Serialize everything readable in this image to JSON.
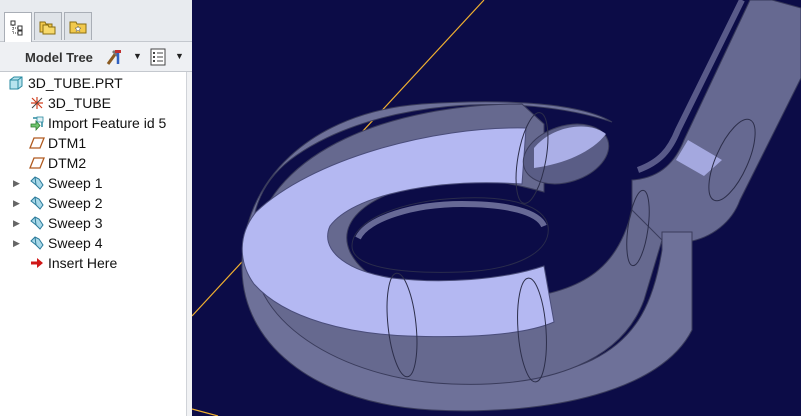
{
  "tabs": {
    "model_tree": "model-tree-tab",
    "folder_browser": "folder-browser-tab",
    "favorites": "favorites-tab"
  },
  "toolbar": {
    "title": "Model Tree"
  },
  "tree": {
    "items": [
      {
        "label": "3D_TUBE.PRT",
        "icon": "part-icon",
        "expandable": false
      },
      {
        "label": "3D_TUBE",
        "icon": "coordinate-system-icon",
        "expandable": false
      },
      {
        "label": "Import Feature id 5",
        "icon": "import-feature-icon",
        "expandable": false
      },
      {
        "label": "DTM1",
        "icon": "datum-plane-icon",
        "expandable": false
      },
      {
        "label": "DTM2",
        "icon": "datum-plane-icon",
        "expandable": false
      },
      {
        "label": "Sweep 1",
        "icon": "sweep-icon",
        "expandable": true
      },
      {
        "label": "Sweep 2",
        "icon": "sweep-icon",
        "expandable": true
      },
      {
        "label": "Sweep 3",
        "icon": "sweep-icon",
        "expandable": true
      },
      {
        "label": "Sweep 4",
        "icon": "sweep-icon",
        "expandable": true
      },
      {
        "label": "Insert Here",
        "icon": "insert-here-arrow-icon",
        "expandable": false
      }
    ]
  },
  "colors": {
    "viewport_background": "#0c0c47",
    "tube_fill": "#6b6e96",
    "cut_face": "#b4b8f2",
    "datum_axis": "#f0b030"
  }
}
